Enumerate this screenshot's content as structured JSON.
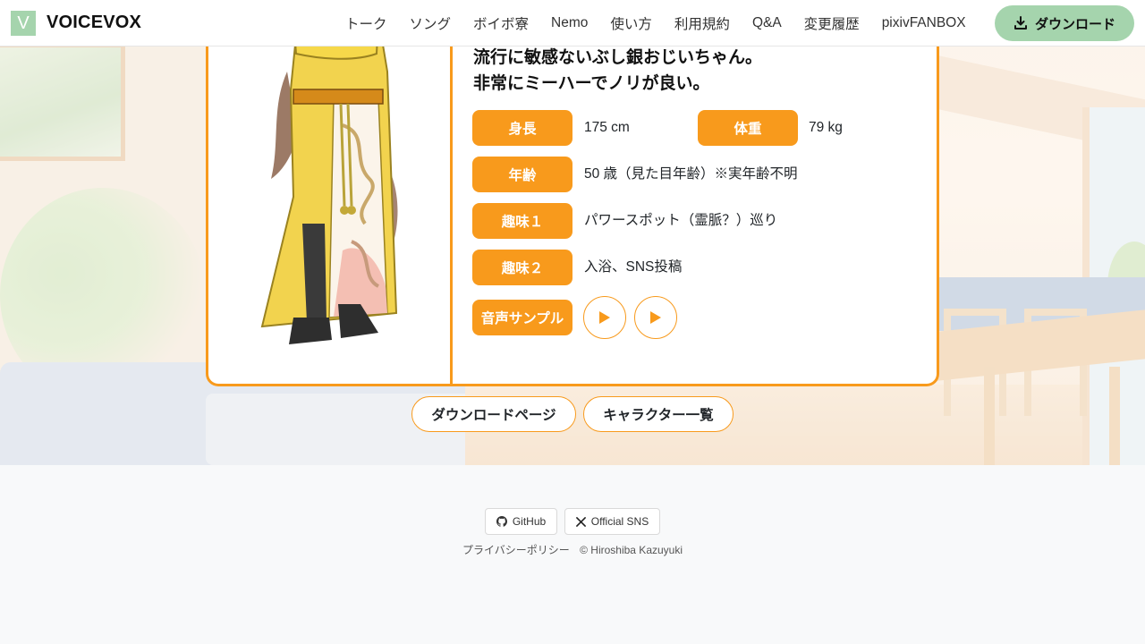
{
  "header": {
    "logo_letter": "V",
    "brand": "VOICEVOX",
    "nav": [
      "トーク",
      "ソング",
      "ボイボ寮",
      "Nemo",
      "使い方",
      "利用規約",
      "Q&A",
      "変更履歴",
      "pixivFANBOX"
    ],
    "download_label": "ダウンロード"
  },
  "character": {
    "description_lines": [
      "流行に敏感ないぶし銀おじいちゃん。",
      "非常にミーハーでノリが良い。"
    ],
    "height_label": "身長",
    "height_value": "175 cm",
    "weight_label": "体重",
    "weight_value": "79 kg",
    "age_label": "年齢",
    "age_value": "50 歳（見た目年齢）※実年齢不明",
    "hobby1_label": "趣味１",
    "hobby1_value": "パワースポット（霊脈？）巡り",
    "hobby2_label": "趣味２",
    "hobby2_value": "入浴、SNS投稿",
    "sample_label": "音声サンプル"
  },
  "buttons": {
    "download_page": "ダウンロードページ",
    "character_list": "キャラクター一覧"
  },
  "footer": {
    "github": "GitHub",
    "sns": "Official SNS",
    "privacy": "プライバシーポリシー",
    "copyright": "© Hiroshiba Kazuyuki"
  },
  "colors": {
    "accent": "#f89a1c",
    "brand_green": "#a5d4ad"
  }
}
